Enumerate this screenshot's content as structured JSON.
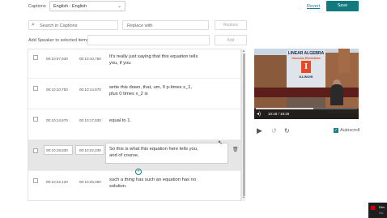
{
  "topbar": {
    "captions_label": "Captions",
    "language_value": "English - English",
    "revert_label": "Revert",
    "save_label": "Save"
  },
  "find_replace": {
    "search_placeholder": "Search in Captions",
    "replace_placeholder": "Replace with",
    "replace_button": "Replace"
  },
  "speaker": {
    "label": "Add Speaker to selected items",
    "add_button": "Add"
  },
  "captions": [
    {
      "start": "00:10:07,930",
      "end": "00:10:10,750",
      "text": "It's really just saying that this equation tells you, if you",
      "active": false
    },
    {
      "start": "00:10:10,750",
      "end": "00:10:14,870",
      "text": "write this down, that, um, 0 p-times x_1, plus 0 times x_2 is",
      "active": false
    },
    {
      "start": "00:10:14,870",
      "end": "00:10:17,830",
      "text": "equal to 1.",
      "active": false
    },
    {
      "start": "00:10:18,830",
      "end": "00:10:22,030",
      "text": "So this is what this equation here tells you, and of course,",
      "active": true
    },
    {
      "start": "00:10:22,120",
      "end": "00:10:25,090",
      "text": "such a thing has such an equation has no solution.",
      "active": false
    }
  ],
  "video": {
    "slide_title": "LINEAR ALGEBRA",
    "slide_subtitle": "Gaussian Elimination",
    "slide_logo": "I",
    "slide_footer": "ILLINOIS",
    "time": "10:28 / 18:28",
    "progress": 0.565
  },
  "player": {
    "autoscroll_label": "Autoscroll",
    "autoscroll_checked": true
  },
  "toast": {
    "line1": "Des",
    "line2": "Go"
  }
}
